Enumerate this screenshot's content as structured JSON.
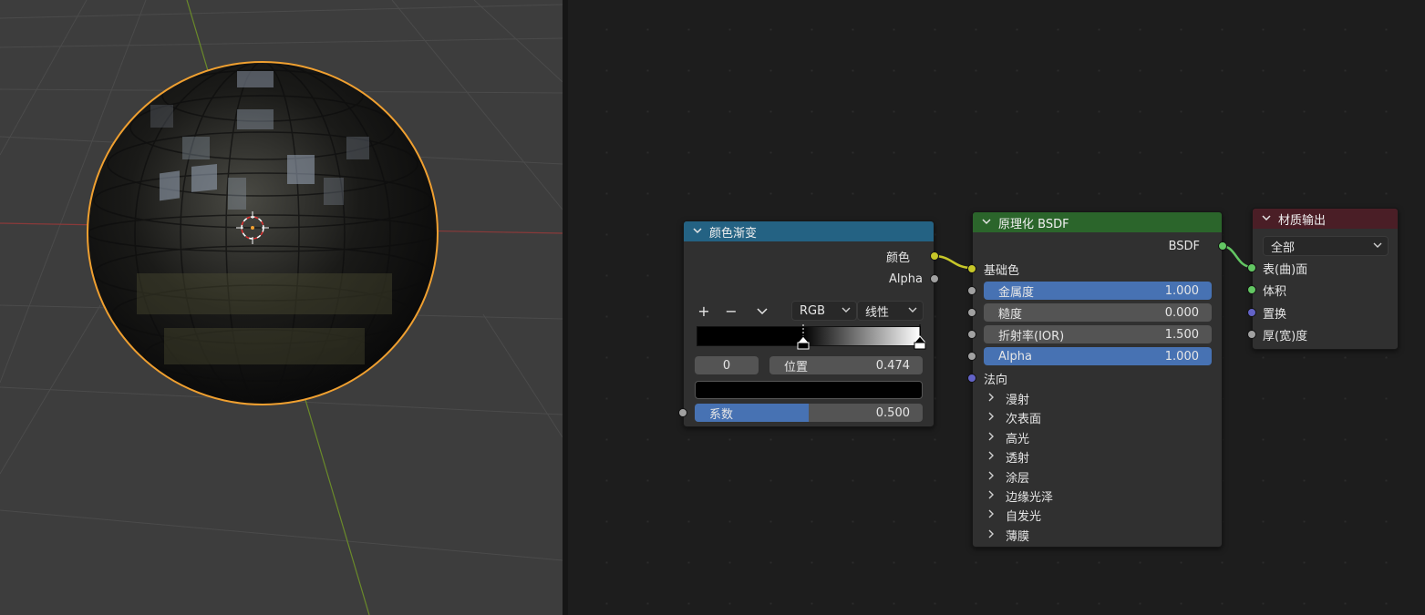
{
  "color_ramp_node": {
    "title": "颜色渐变",
    "header_color": "#246283",
    "outputs": [
      "颜色",
      "Alpha"
    ],
    "add_button": "+",
    "remove_button": "−",
    "menu_chevron": "chevron-down",
    "color_mode": "RGB",
    "interpolation": "线性",
    "active_stop_index": "0",
    "position_label": "位置",
    "position_value": "0.474",
    "stop_color": "#000000",
    "factor_label": "系数",
    "factor_value": "0.500",
    "factor_fraction": 0.5
  },
  "bsdf_node": {
    "title": "原理化 BSDF",
    "header_color": "#2b652b",
    "output": "BSDF",
    "base_color_label": "基础色",
    "metallic_label": "金属度",
    "metallic_value": "1.000",
    "roughness_label": "糙度",
    "roughness_value": "0.000",
    "ior_label": "折射率(IOR)",
    "ior_value": "1.500",
    "alpha_label": "Alpha",
    "alpha_value": "1.000",
    "normal_label": "法向",
    "panels": [
      "漫射",
      "次表面",
      "高光",
      "透射",
      "涂层",
      "边缘光泽",
      "自发光",
      "薄膜"
    ]
  },
  "material_output_node": {
    "title": "材质输出",
    "header_color": "#4a1e26",
    "target": "全部",
    "inputs": [
      "表(曲)面",
      "体积",
      "置换",
      "厚(宽)度"
    ]
  },
  "colors": {
    "socket_yellow": "#c7c729",
    "socket_green": "#63c763",
    "socket_grey": "#a1a1a1",
    "socket_purple": "#6363c7",
    "accent_blue": "#4772b3",
    "selection_orange": "#f0a030"
  }
}
